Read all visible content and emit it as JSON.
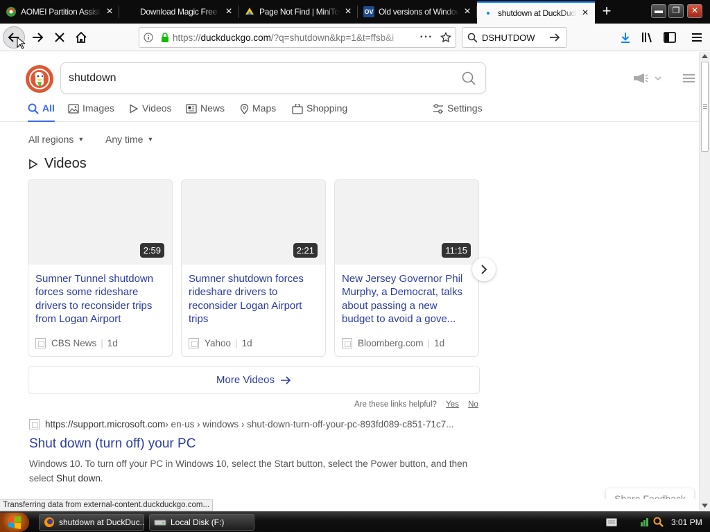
{
  "browser": {
    "tabs": [
      {
        "title": "AOMEI Partition Assista",
        "icon": "aomei-icon",
        "active": false
      },
      {
        "title": "Download Magic Free P",
        "icon": "page-icon",
        "active": false
      },
      {
        "title": "Page Not Find | MiniToo",
        "icon": "minitool-icon",
        "active": false
      },
      {
        "title": "Old versions of Window",
        "icon": "ov-icon",
        "icon_text": "OV",
        "active": false
      },
      {
        "title": "shutdown at DuckDuck",
        "icon": "duckduckgo-icon",
        "active": true
      }
    ],
    "url_prefix": "https://",
    "url_domain": "duckduckgo.com",
    "url_rest": "/?q=shutdown&kp=1&t=ffsb&i",
    "search_value": "DSHUTDOW",
    "accent_color": "#0a84ff"
  },
  "ddg": {
    "query": "shutdown",
    "nav_tabs": [
      {
        "label": "All",
        "icon": "search-icon",
        "active": true
      },
      {
        "label": "Images",
        "icon": "image-icon"
      },
      {
        "label": "Videos",
        "icon": "play-icon"
      },
      {
        "label": "News",
        "icon": "news-icon"
      },
      {
        "label": "Maps",
        "icon": "map-pin-icon"
      },
      {
        "label": "Shopping",
        "icon": "shopping-bag-icon"
      }
    ],
    "settings_label": "Settings",
    "filters": {
      "region": "All regions",
      "time": "Any time"
    },
    "videos_heading": "Videos",
    "videos": [
      {
        "duration": "2:59",
        "title": "Sumner Tunnel shutdown forces some rideshare drivers to reconsider trips from Logan Airport",
        "source": "CBS News",
        "age": "1d"
      },
      {
        "duration": "2:21",
        "title": "Sumner shutdown forces rideshare drivers to reconsider Logan Airport trips",
        "source": "Yahoo",
        "age": "1d"
      },
      {
        "duration": "11:15",
        "title": "New Jersey Governor Phil Murphy, a Democrat, talks about passing a new budget to avoid a gove...",
        "source": "Bloomberg.com",
        "age": "1d"
      }
    ],
    "more_videos_label": "More Videos",
    "helpful_question": "Are these links helpful?",
    "helpful_yes": "Yes",
    "helpful_no": "No",
    "result": {
      "domain": "https://support.microsoft.com",
      "path": " › en-us › windows › shut-down-turn-off-your-pc-893fd089-c851-71c7...",
      "title": "Shut down (turn off) your PC",
      "snippet_before": "Windows 10. To turn off your PC in Windows 10, select the Start button, select the Power button, and then select ",
      "snippet_bold": "Shut down",
      "snippet_after": "."
    },
    "share_feedback": "Share Feedback",
    "link_color": "#2a3ca3",
    "brand_color": "#de5833"
  },
  "status_text": "Transferring data from external-content.duckduckgo.com...",
  "taskbar": {
    "tasks": [
      {
        "label": "shutdown at DuckDuc...",
        "icon": "firefox-icon"
      },
      {
        "label": "Local Disk (F:)",
        "icon": "drive-icon"
      }
    ],
    "clock": "3:01 PM"
  }
}
